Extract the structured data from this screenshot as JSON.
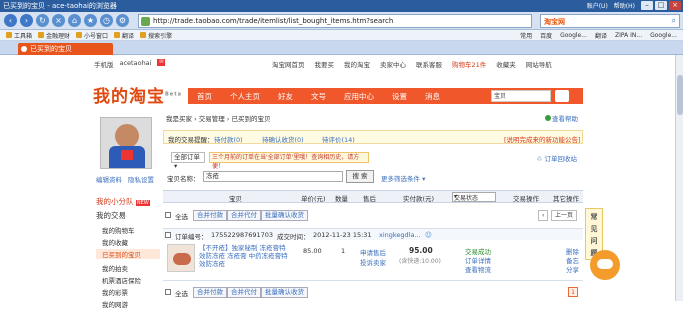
{
  "browser": {
    "title": "已买到的宝贝 - ace-taohai的浏览器",
    "menu": [
      "账户(U)",
      "帮助(H)"
    ],
    "url": "http://trade.taobao.com/trade/itemlist/list_bought_items.htm?search",
    "search_logo": "淘宝网",
    "bookmarks": [
      "工具箱",
      "金融理财",
      "小号窗口",
      "翻译",
      "搜索引擎"
    ],
    "bookmarks_right": [
      "常用",
      "百度",
      "Google...",
      "翻译",
      "ZIPA IN...",
      "Google..."
    ],
    "tab": "已买到的宝贝"
  },
  "site_top": {
    "mobile": "手机版",
    "user": "acetaohai",
    "links": [
      "淘宝网首页",
      "我要买",
      "我的淘宝",
      "卖家中心",
      "联系客服",
      "购物车21件",
      "收藏夹",
      "网站导航"
    ]
  },
  "banner": {
    "logo": "我的淘宝",
    "beta": "Beta",
    "nav": [
      "首页",
      "个人主页",
      "好友",
      "文号",
      "应用中心",
      "设置",
      "消息"
    ],
    "search_placeholder": "宝贝"
  },
  "sidebar": {
    "avatar_links": [
      "编辑资料",
      "隐私设置"
    ],
    "items": [
      {
        "label": "我的小分队",
        "badge": "NEW"
      },
      {
        "label": "我的交易"
      },
      {
        "label": "我的购物车"
      },
      {
        "label": "我的收藏"
      },
      {
        "label": "已买到的宝贝"
      },
      {
        "label": "我的拍卖"
      },
      {
        "label": "机票酒店保险"
      },
      {
        "label": "我的彩票"
      },
      {
        "label": "我的网游"
      }
    ]
  },
  "content": {
    "breadcrumb": "我是买家 › 交易管理 › 已买到的宝贝",
    "help": "查看帮助",
    "filters": {
      "prompt": "我的交易提醒：",
      "items": [
        "待付款(0)",
        "待确认收货(0)",
        "待评价(14)"
      ],
      "notice": "[说明完成来的新功能公告]"
    },
    "order_type": "全部订单",
    "tip": "三个月前的订单在当'全部订单'里哦！查询相历史，请方便！",
    "order_recycle": "订单回收站",
    "search_label": "宝贝名称：",
    "search_value": "冻疮",
    "search_button": "搜 索",
    "more_filters": "更多筛选条件",
    "columns": [
      "宝贝",
      "单价(元)",
      "数量",
      "售后",
      "实付款(元)",
      "交易状态",
      "交易操作",
      "其它操作"
    ],
    "status_select": "交易状态",
    "batch": {
      "select_all": "全选",
      "buttons": [
        "合并付款",
        "合并代付",
        "批量确认收货"
      ],
      "pager": [
        "‹",
        "上一页",
        "下一页",
        "›"
      ]
    },
    "order": {
      "number_label": "订单编号：",
      "number": "175522987691703",
      "time_label": "成交时间：",
      "time": "2012-11-23 15:31",
      "seller": "xingkegdla..."
    },
    "item": {
      "title": "【不开疮】独家秘制 冻疮膏特效防冻疮 冻疮膏 中药冻疮膏特效防冻疮",
      "price": "85.00",
      "qty": "1",
      "after_sale": [
        "申请售后",
        "投诉卖家"
      ],
      "total": "95.00",
      "shipping": "(含快递:10.00)",
      "status": [
        "交易成功",
        "订单详情",
        "查看物流"
      ],
      "ops": [
        "删除",
        "备忘",
        "分享"
      ]
    },
    "faq": "常见问题",
    "page": "1"
  }
}
